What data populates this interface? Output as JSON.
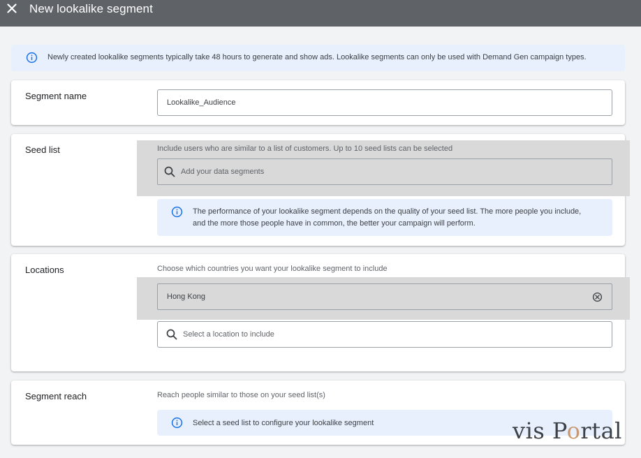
{
  "header": {
    "title": "New lookalike segment",
    "close_icon": "close-icon"
  },
  "banner": {
    "icon": "info-icon",
    "text": "Newly created lookalike segments typically take 48 hours to generate and show ads. Lookalike segments can only be used with Demand Gen campaign types."
  },
  "segment_name": {
    "label": "Segment name",
    "value": "Lookalike_Audience"
  },
  "seed_list": {
    "label": "Seed list",
    "hint": "Include users who are similar to a list of customers. Up to 10 seed lists can be selected",
    "search_placeholder": "Add your data segments",
    "notice": "The performance of your lookalike segment depends on the quality of your seed list. The more people you include, and the more those people have in common, the better your campaign will perform."
  },
  "locations": {
    "label": "Locations",
    "hint": "Choose which countries you want your lookalike segment to include",
    "selected": "Hong Kong",
    "search_placeholder": "Select a location to include"
  },
  "segment_reach": {
    "label": "Segment reach",
    "hint": "Reach people similar to those on your seed list(s)",
    "notice": "Select a seed list to configure your lookalike segment"
  },
  "watermark": {
    "part1": "vis P",
    "part2": "o",
    "part3": "rtal"
  },
  "colors": {
    "header_bg": "#5f6368",
    "info_blue": "#1a73e8",
    "notice_bg": "#e8f0fe",
    "highlight": "#d9d9d9"
  }
}
